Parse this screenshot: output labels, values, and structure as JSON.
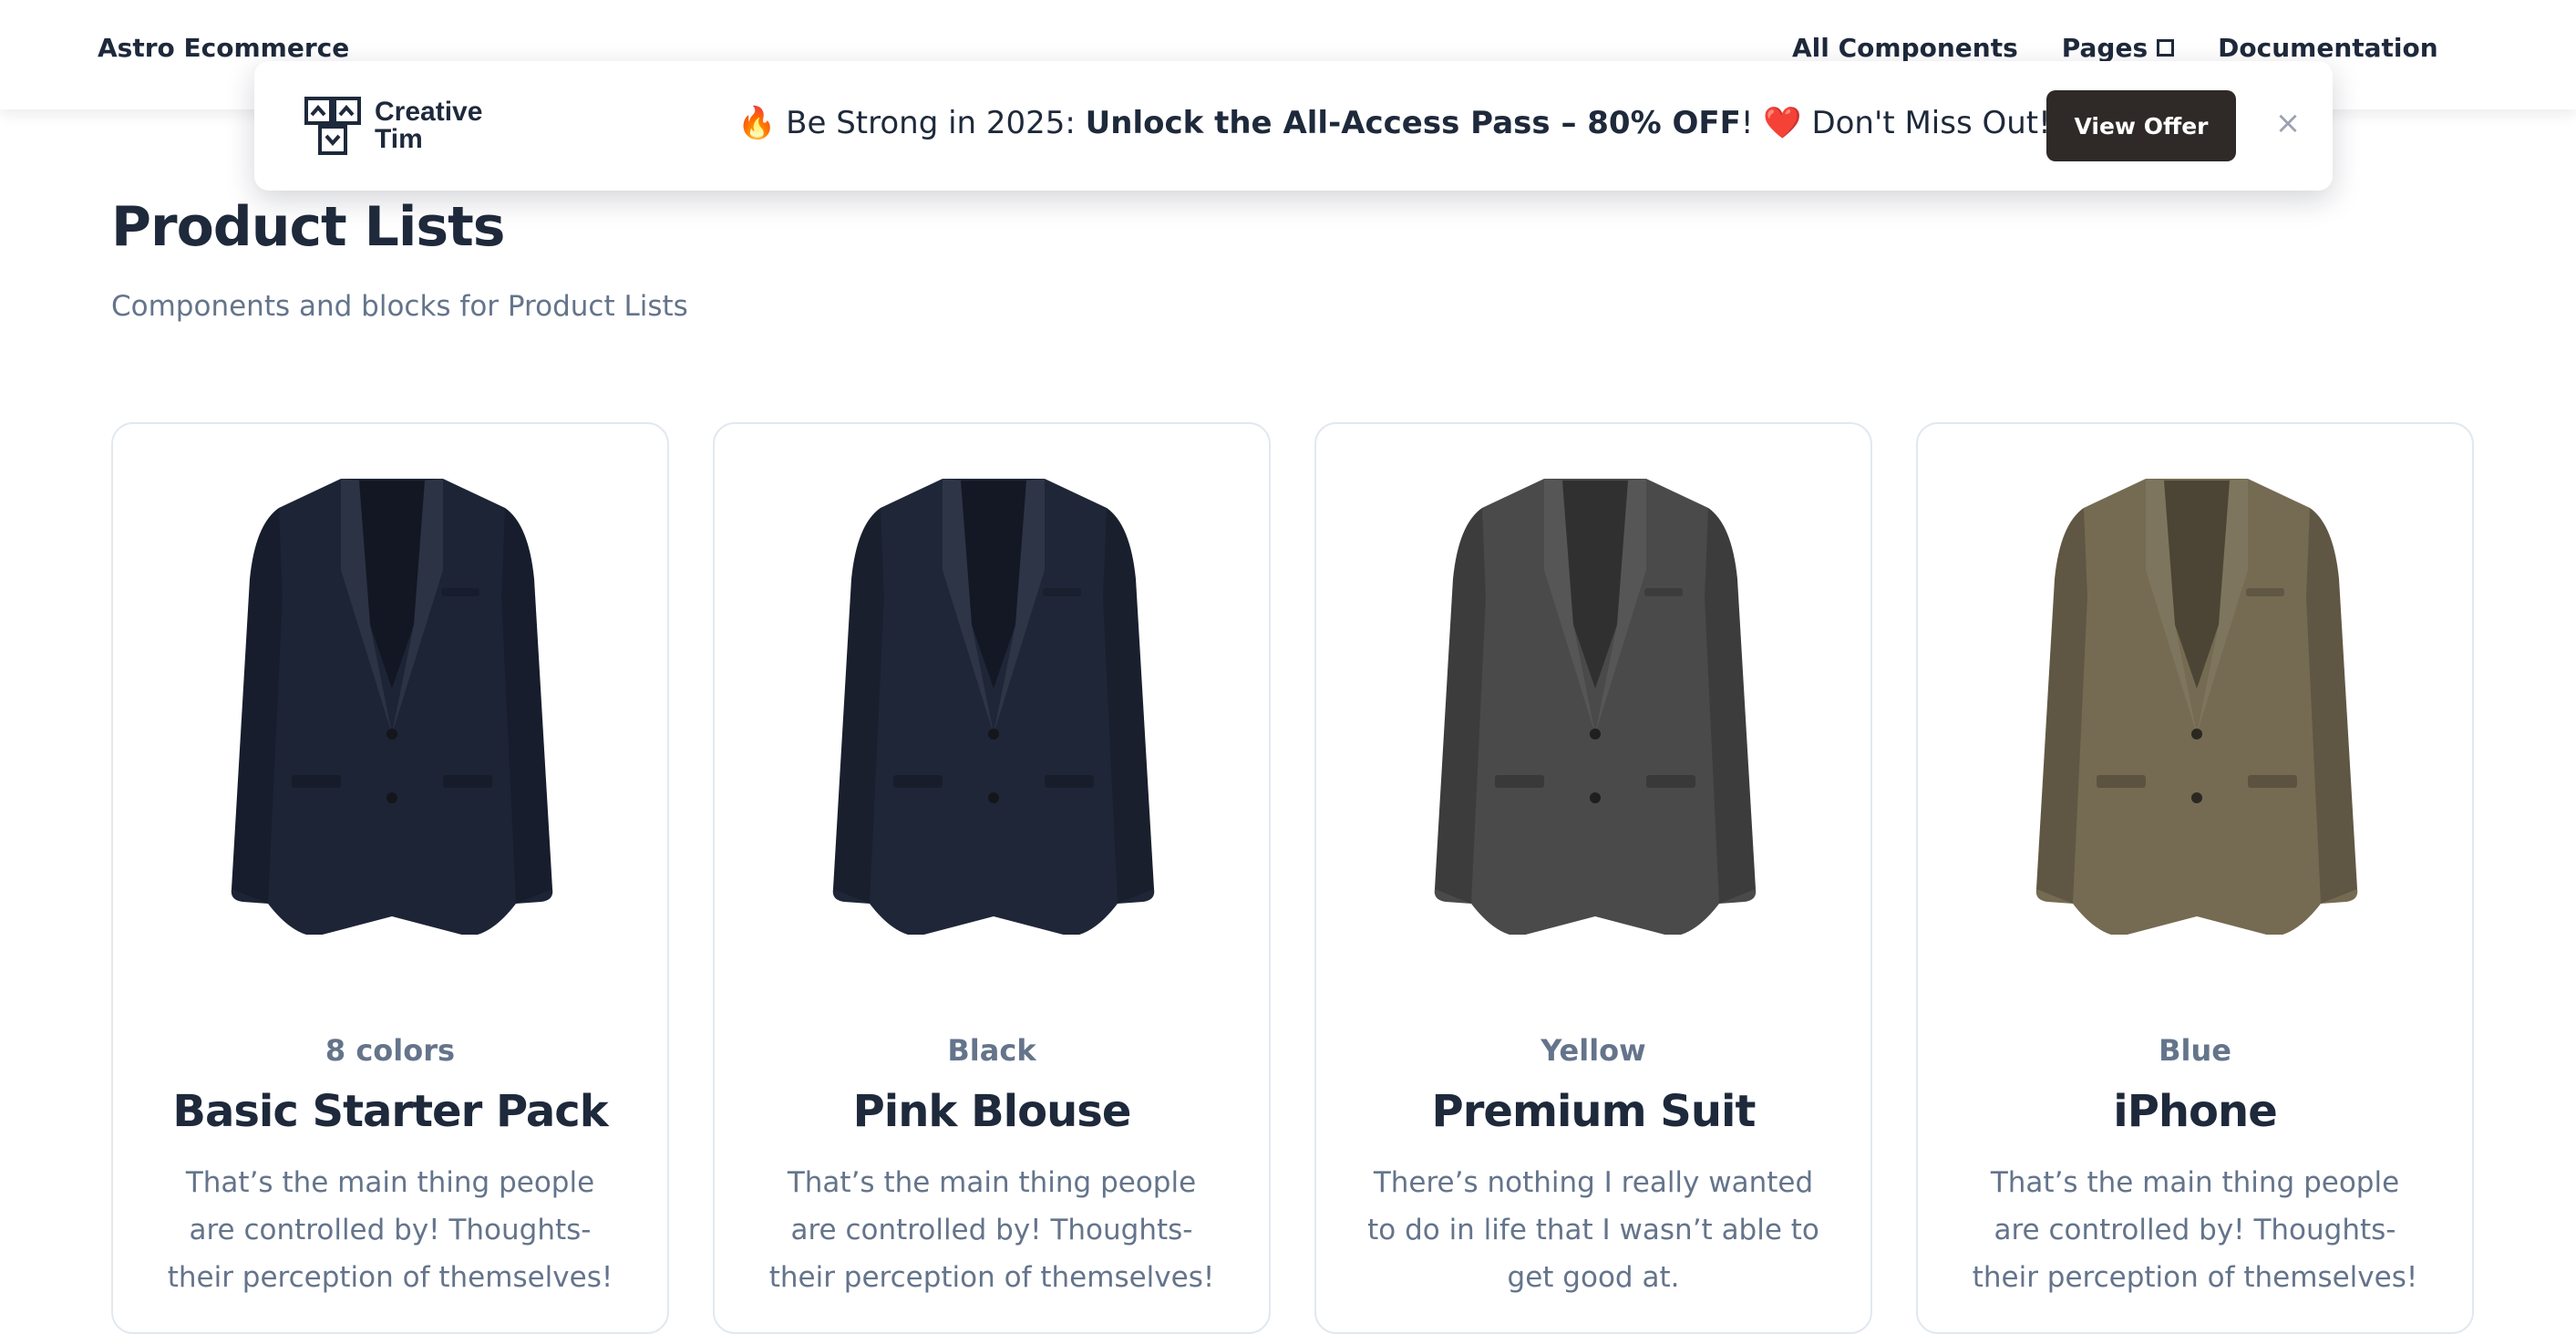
{
  "navbar": {
    "brand": "Astro Ecommerce",
    "links": [
      "All Components",
      "Pages",
      "Documentation"
    ]
  },
  "promo": {
    "logo_line1": "Creative",
    "logo_line2": "Tim",
    "text_pre": "🔥 Be Strong in 2025: ",
    "text_bold": "Unlock the All-Access Pass – 80% OFF",
    "text_post": "! ❤️ Don't Miss Out!",
    "button": "View Offer",
    "close": "×"
  },
  "page": {
    "title": "Product Lists",
    "subtitle": "Components and blocks for Product Lists"
  },
  "products": [
    {
      "variant": "8 colors",
      "title": "Basic Starter Pack",
      "description": "That’s the main thing people are controlled by! Thoughts- their perception of themselves!",
      "color": "#1d2436"
    },
    {
      "variant": "Black",
      "title": "Pink Blouse",
      "description": "That’s the main thing people are controlled by! Thoughts- their perception of themselves!",
      "color": "#1f2638"
    },
    {
      "variant": "Yellow",
      "title": "Premium Suit",
      "description": "There’s nothing I really wanted to do in life that I wasn’t able to get good at.",
      "color": "#4a4a4a"
    },
    {
      "variant": "Blue",
      "title": "iPhone",
      "description": "That’s the main thing people are controlled by! Thoughts- their perception of themselves!",
      "color": "#756b52"
    }
  ]
}
